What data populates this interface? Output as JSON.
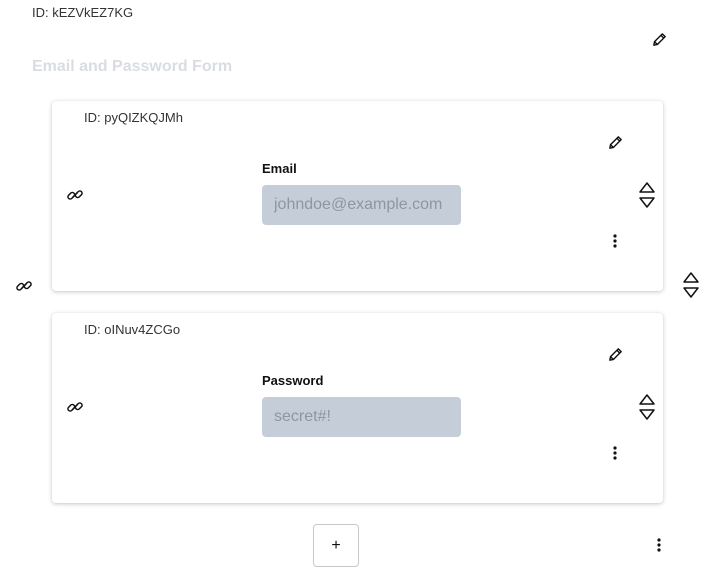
{
  "root": {
    "id_text": "ID: kEZVkEZ7KG",
    "title": "Email and Password Form"
  },
  "cards": [
    {
      "id_text": "ID: pyQIZKQJMh",
      "label": "Email",
      "placeholder": "johndoe@example.com"
    },
    {
      "id_text": "ID: oINuv4ZCGo",
      "label": "Password",
      "placeholder": "secret#!"
    }
  ],
  "add_button_label": "+",
  "icons": {
    "edit": "pencil-icon",
    "link": "chain-link-icon",
    "reorder": "up-down-arrows-icon",
    "more": "vertical-dots-icon"
  }
}
